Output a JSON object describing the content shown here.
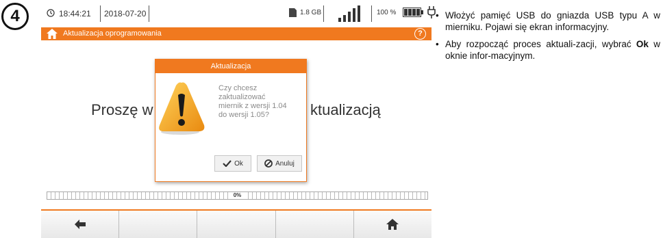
{
  "step": {
    "number": "4"
  },
  "status_bar": {
    "time": "18:44:21",
    "date": "2018-07-20",
    "storage": "1.8 GB",
    "battery": "100 %"
  },
  "title_bar": {
    "title": "Aktualizacja oprogramowania",
    "help": "?"
  },
  "background": {
    "text_left": "Proszę w",
    "text_right": "ktualizacją"
  },
  "dialog": {
    "title": "Aktualizacja",
    "message": "Czy chcesz\nzaktualizować\nmiernik z wersji 1.04\ndo wersji 1.05?",
    "ok_label": "Ok",
    "cancel_label": "Anuluj"
  },
  "progress": {
    "label": "0%",
    "value": 0
  },
  "bottom_bar": {
    "left_icon": "arrow-left-icon",
    "right_icon": "home-icon"
  },
  "instructions": {
    "item1": "Włożyć pamięć USB do gniazda USB typu A w mierniku. Pojawi się ekran informacyjny.",
    "item2_before": "Aby rozpocząć proces aktuali-zacji, wybrać ",
    "item2_bold": "Ok",
    "item2_after": " w oknie infor-macyjnym."
  },
  "colors": {
    "accent": "#f0791f",
    "warning": "#f4a21c"
  }
}
